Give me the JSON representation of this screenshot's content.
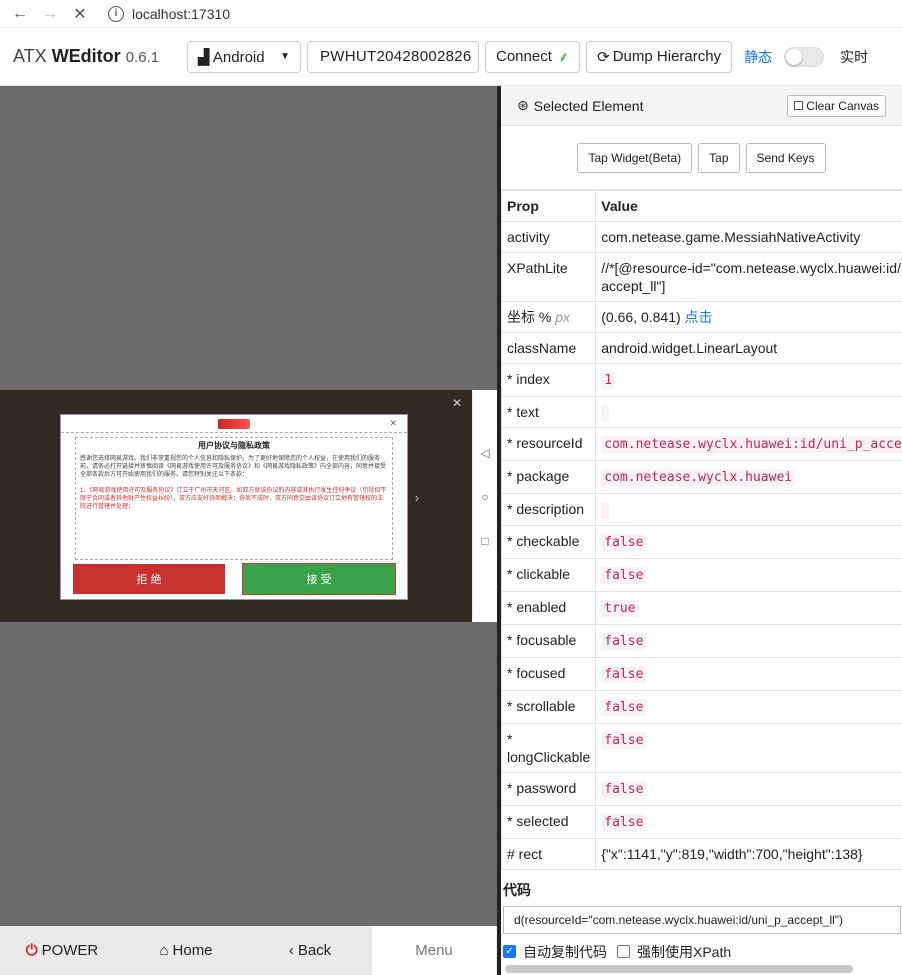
{
  "browser": {
    "url": "localhost:17310"
  },
  "app": {
    "brand_prefix": "ATX",
    "brand_name": "WEditor",
    "version": "0.6.1",
    "platform": "Android",
    "serial": "PWHUT20428002826",
    "connect_label": "Connect",
    "dump_label": "Dump Hierarchy",
    "static_label": "静态",
    "realtime_label": "实时"
  },
  "device_screen": {
    "dialog": {
      "title": "用户协议与隐私政策",
      "body": "感谢您选择网易游戏。我们非常重视您的个人信息和隐私保护。为了更好地保障您的个人权益，在使用我们的服务前，请务必打开链接并审慎阅读《网易游戏使用许可及服务协议》和《网易游戏隐私政策》内全部内容，同意并接受全部条款后方可开始使用我们的服务。请您特别关注以下条款：",
      "red_text": "1、《网易游戏使用许可及服务协议》订立于广州市天河区。如双方就该协议的内容或其执行发生任何争议（包括但不限于合同或者其他财产性权益纠纷），双方应友好协商解决；协商不成时，双方同意交由该协议订立地有管辖权的法院进行管辖并处理；",
      "reject": "拒 绝",
      "accept": "接 受"
    }
  },
  "device_buttons": {
    "power": "POWER",
    "home": "Home",
    "back": "Back",
    "menu": "Menu"
  },
  "panel": {
    "title": "Selected Element",
    "clear_canvas": "Clear Canvas",
    "actions": {
      "tap_widget": "Tap Widget(Beta)",
      "tap": "Tap",
      "send_keys": "Send Keys"
    },
    "headers": {
      "prop": "Prop",
      "value": "Value"
    },
    "props": {
      "activity": {
        "k": "activity",
        "v": "com.netease.game.MessiahNativeActivity"
      },
      "xpath": {
        "k": "XPathLite",
        "v": "//*[@resource-id=\"com.netease.wyclx.huawei:id/uni_p_accept_ll\"]"
      },
      "coord": {
        "k": "坐标 %",
        "unit": "px",
        "v": "(0.66, 0.841)",
        "link": "点击"
      },
      "classname": {
        "k": "className",
        "v": "android.widget.LinearLayout"
      },
      "index": {
        "k": "* index",
        "v": "1"
      },
      "text": {
        "k": "* text",
        "v": ""
      },
      "resourceid": {
        "k": "* resourceId",
        "v": "com.netease.wyclx.huawei:id/uni_p_accept_ll"
      },
      "package": {
        "k": "* package",
        "v": "com.netease.wyclx.huawei"
      },
      "description": {
        "k": "* description",
        "v": ""
      },
      "checkable": {
        "k": "* checkable",
        "v": "false"
      },
      "clickable": {
        "k": "* clickable",
        "v": "false"
      },
      "enabled": {
        "k": "* enabled",
        "v": "true"
      },
      "focusable": {
        "k": "* focusable",
        "v": "false"
      },
      "focused": {
        "k": "* focused",
        "v": "false"
      },
      "scrollable": {
        "k": "* scrollable",
        "v": "false"
      },
      "longclickable": {
        "k": "* longClickable",
        "v": "false"
      },
      "password": {
        "k": "* password",
        "v": "false"
      },
      "selected": {
        "k": "* selected",
        "v": "false"
      },
      "rect": {
        "k": "# rect",
        "v": "{\"x\":1141,\"y\":819,\"width\":700,\"height\":138}"
      }
    },
    "code_label": "代码",
    "code": "d(resourceId=\"com.netease.wyclx.huawei:id/uni_p_accept_ll\")",
    "auto_copy_label": "自动复制代码",
    "auto_copy_checked": true,
    "force_xpath_label": "强制使用XPath",
    "force_xpath_checked": false
  },
  "colors": {
    "accent": "#1677ff",
    "power": "#e0201a",
    "reject": "#c8312e",
    "accept": "#3aa24a",
    "code": "#c7254e"
  }
}
